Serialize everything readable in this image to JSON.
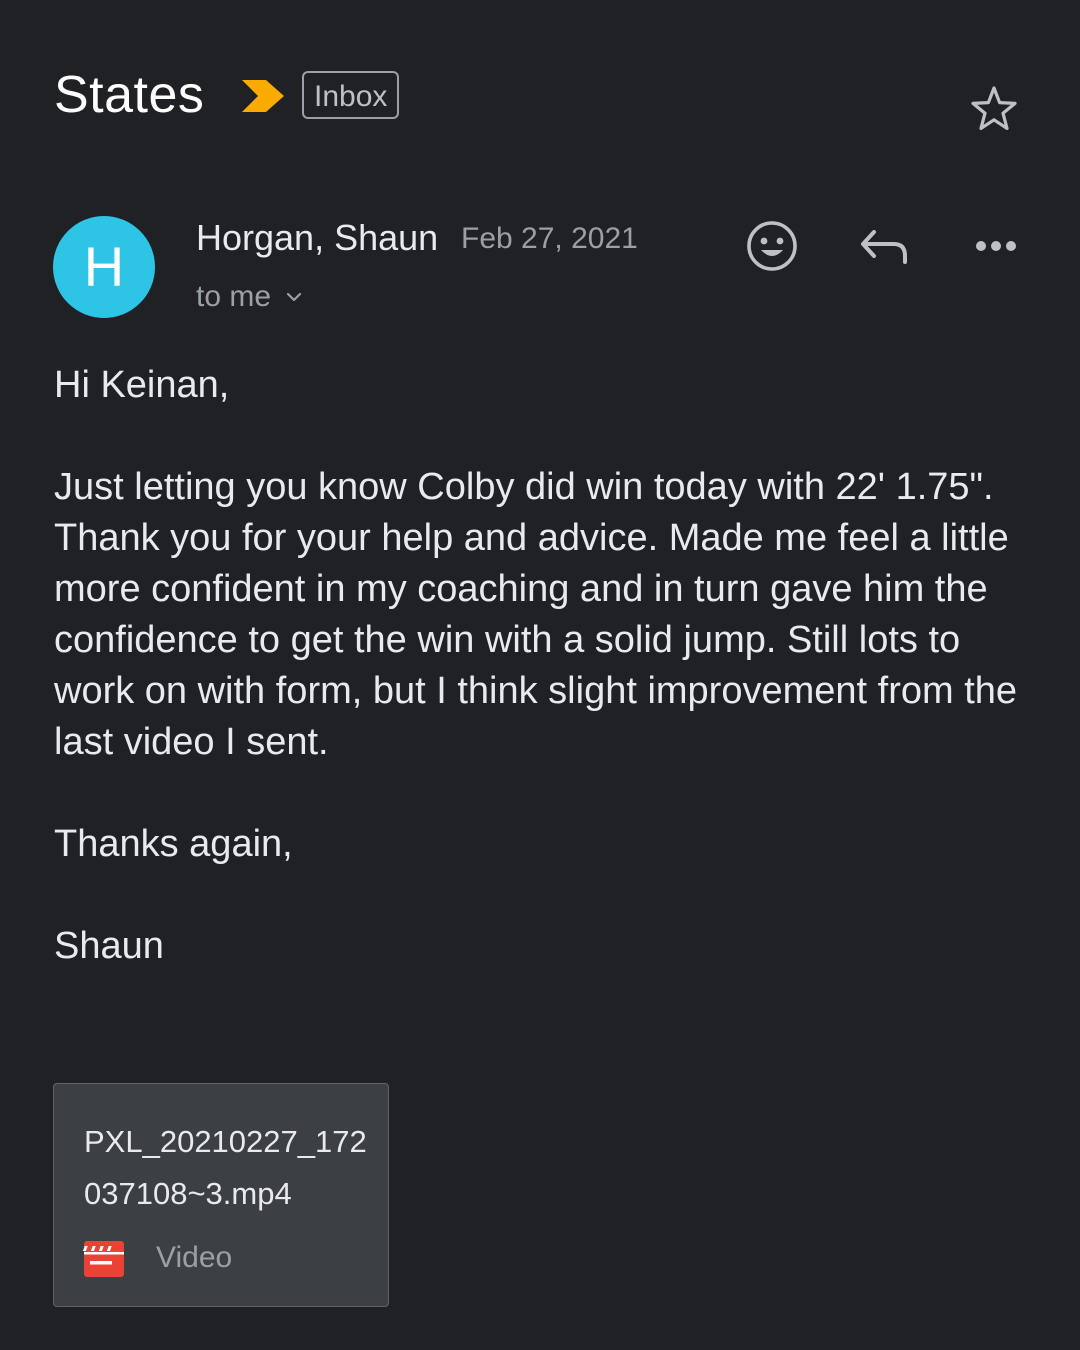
{
  "header": {
    "subject": "States",
    "label": "Inbox",
    "importance_color": "#f9ab00"
  },
  "message": {
    "avatar_letter": "H",
    "avatar_color": "#2ec4e6",
    "sender": "Horgan, Shaun",
    "date": "Feb 27, 2021",
    "recipient": "to me"
  },
  "actions": {
    "emoji_icon": "smiley-icon",
    "reply_icon": "reply-icon",
    "more_icon": "more-horizontal-icon",
    "star_icon": "star-outline-icon"
  },
  "body": {
    "greeting": "Hi Keinan,",
    "paragraph": "Just letting you know Colby did win today with 22' 1.75\".  Thank you for your help and advice. Made me feel a little more confident in my coaching and in turn gave him the confidence to get the win with a solid jump. Still lots to work on with form, but I think slight improvement from the last video I sent.",
    "closing": "Thanks again,",
    "signature": "Shaun"
  },
  "attachment": {
    "filename": "PXL_20210227_172037108~3.mp4",
    "type": "Video",
    "icon": "video-clapperboard-icon",
    "icon_color": "#ea4335"
  }
}
